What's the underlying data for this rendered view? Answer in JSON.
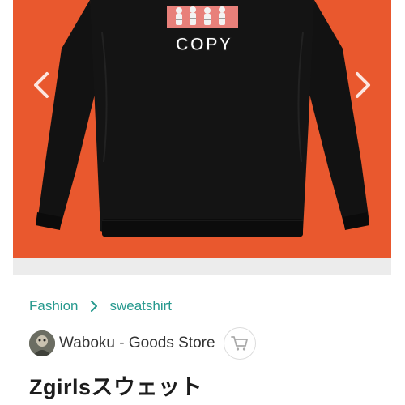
{
  "product": {
    "title": "Zgirlsスウェット",
    "print_text": "COPY",
    "colors": {
      "background": "#e9582e",
      "garment": "#111111",
      "print_text": "#ffffff"
    }
  },
  "gallery": {
    "prev_icon": "chevron-left-icon",
    "next_icon": "chevron-right-icon"
  },
  "breadcrumb": {
    "items": [
      "Fashion",
      "sweatshirt"
    ],
    "separator_icon": "chevron-right-icon",
    "color": "#26998e"
  },
  "store": {
    "name": "Waboku - Goods Store",
    "avatar_icon": "avatar",
    "cart_icon": "cart-icon"
  }
}
